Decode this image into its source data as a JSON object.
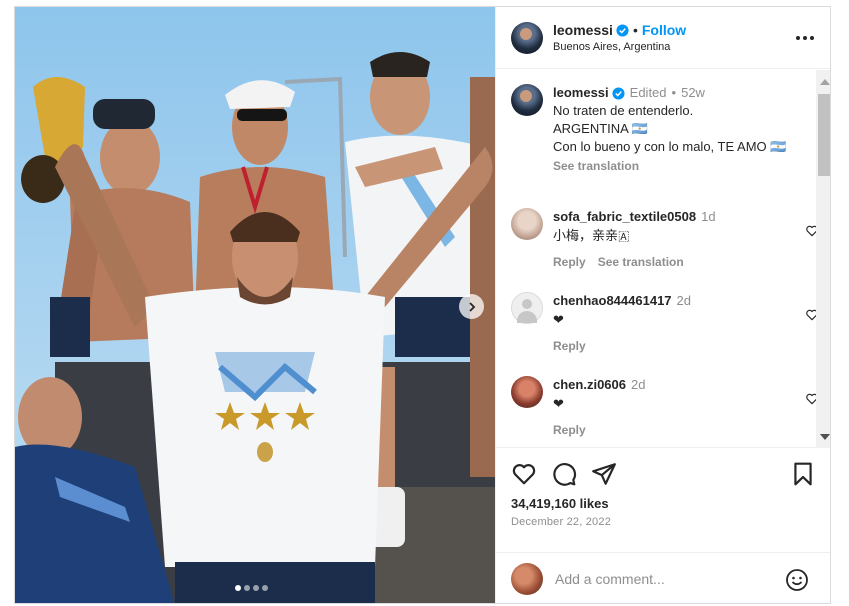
{
  "post": {
    "image_description_icons": [
      "chevron-right-icon"
    ],
    "carousel": {
      "count": 4,
      "active": 0
    }
  },
  "header": {
    "username": "leomessi",
    "separator": "•",
    "follow_label": "Follow",
    "location": "Buenos Aires, Argentina"
  },
  "caption": {
    "username": "leomessi",
    "edited": "Edited",
    "dot": "•",
    "age": "52w",
    "lines": [
      "No traten de entenderlo.",
      "ARGENTINA 🇦🇷",
      "Con lo bueno y con lo malo, TE AMO 🇦🇷"
    ],
    "see_translation": "See translation"
  },
  "comments": [
    {
      "username": "sofa_fabric_textile0508",
      "age": "1d",
      "text": "小梅，亲亲🇦",
      "reply": "Reply",
      "see_translation": "See translation"
    },
    {
      "username": "chenhao844461417",
      "age": "2d",
      "text": "❤",
      "reply": "Reply"
    },
    {
      "username": "chen.zi0606",
      "age": "2d",
      "text": "❤",
      "reply": "Reply"
    }
  ],
  "stats": {
    "likes": "34,419,160 likes",
    "date": "December 22, 2022"
  },
  "add_comment": {
    "placeholder": "Add a comment..."
  },
  "colors": {
    "accent": "#0095f6",
    "text": "#262626",
    "muted": "#8e8e8e",
    "border": "#efefef"
  }
}
